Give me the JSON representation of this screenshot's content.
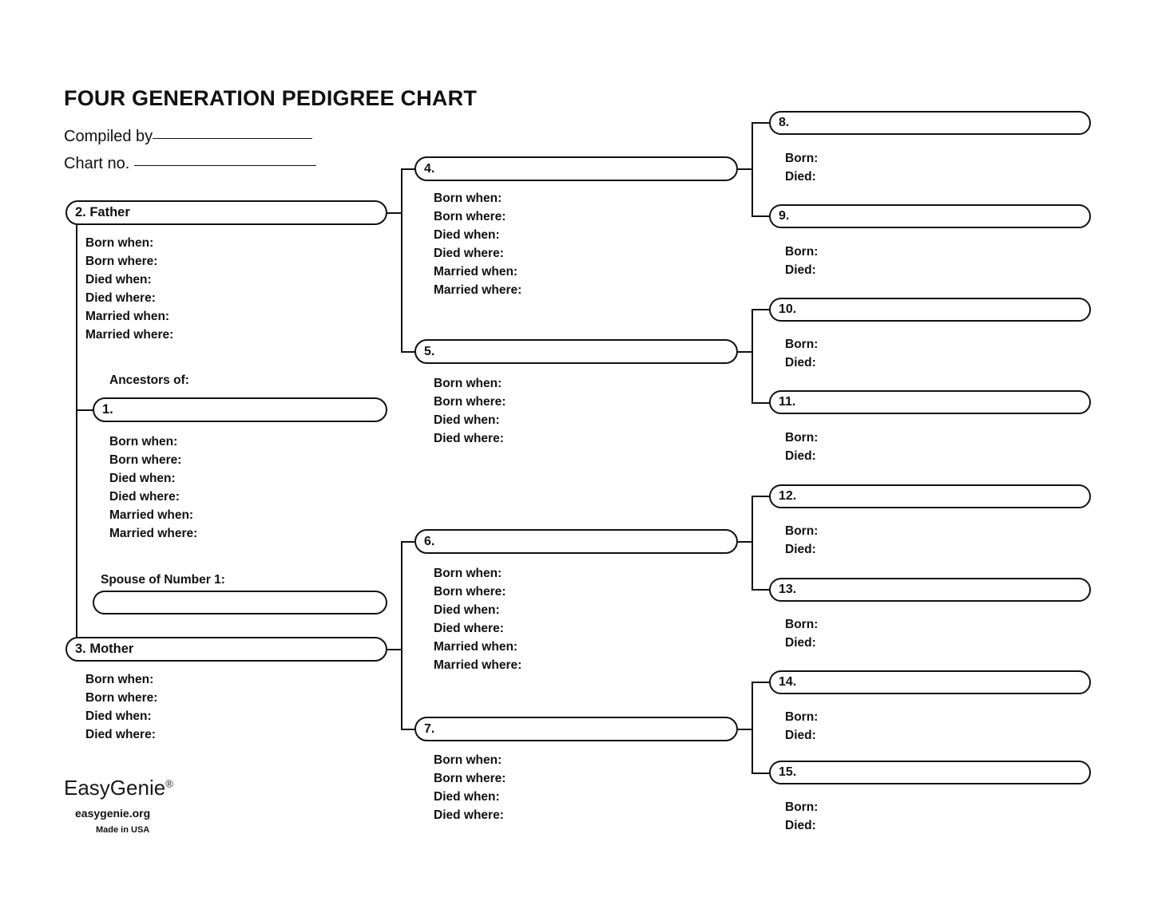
{
  "document": {
    "title": "FOUR GENERATION PEDIGREE CHART"
  },
  "meta": {
    "compiled_by_label": "Compiled by",
    "chart_no_label": "Chart no."
  },
  "captions": {
    "ancestors_of": "Ancestors of:",
    "spouse_of_number_1": "Spouse of Number 1:"
  },
  "field_sets": {
    "full": "Born when:\nBorn where:\nDied when:\nDied where:\nMarried when:\nMarried where:",
    "short": "Born when:\nBorn where:\nDied when:\nDied where:",
    "minimal": "Born:\nDied:"
  },
  "generations": {
    "gen1": {
      "boxes": [
        {
          "id": "box-1",
          "label": "1.",
          "fields": "Born when:\nBorn where:\nDied when:\nDied where:\nMarried when:\nMarried where:"
        },
        {
          "id": "box-spouse",
          "label": "",
          "fields": ""
        }
      ]
    },
    "gen2": {
      "boxes": [
        {
          "id": "box-2",
          "label": "2. Father",
          "fields": "Born when:\nBorn where:\nDied when:\nDied where:\nMarried when:\nMarried where:"
        },
        {
          "id": "box-3",
          "label": "3. Mother",
          "fields": "Born when:\nBorn where:\nDied when:\nDied where:"
        }
      ]
    },
    "gen3": {
      "boxes": [
        {
          "id": "box-4",
          "label": "4.",
          "fields": "Born when:\nBorn where:\nDied when:\nDied where:\nMarried when:\nMarried where:"
        },
        {
          "id": "box-5",
          "label": "5.",
          "fields": "Born when:\nBorn where:\nDied when:\nDied where:"
        },
        {
          "id": "box-6",
          "label": "6.",
          "fields": "Born when:\nBorn where:\nDied when:\nDied where:\nMarried when:\nMarried where:"
        },
        {
          "id": "box-7",
          "label": "7.",
          "fields": "Born when:\nBorn where:\nDied when:\nDied where:"
        }
      ]
    },
    "gen4": {
      "boxes": [
        {
          "id": "box-8",
          "label": "8.",
          "fields": "Born:\nDied:"
        },
        {
          "id": "box-9",
          "label": "9.",
          "fields": "Born:\nDied:"
        },
        {
          "id": "box-10",
          "label": "10.",
          "fields": "Born:\nDied:"
        },
        {
          "id": "box-11",
          "label": "11.",
          "fields": "Born:\nDied:"
        },
        {
          "id": "box-12",
          "label": "12.",
          "fields": "Born:\nDied:"
        },
        {
          "id": "box-13",
          "label": "13.",
          "fields": "Born:\nDied:"
        },
        {
          "id": "box-14",
          "label": "14.",
          "fields": "Born:\nDied:"
        },
        {
          "id": "box-15",
          "label": "15.",
          "fields": "Born:\nDied:"
        }
      ]
    }
  },
  "footer": {
    "brand": "EasyGenie",
    "brand_mark": "®",
    "url": "easygenie.org",
    "made_in": "Made in USA"
  },
  "colors": {
    "ink": "#111111",
    "paper": "#ffffff"
  }
}
